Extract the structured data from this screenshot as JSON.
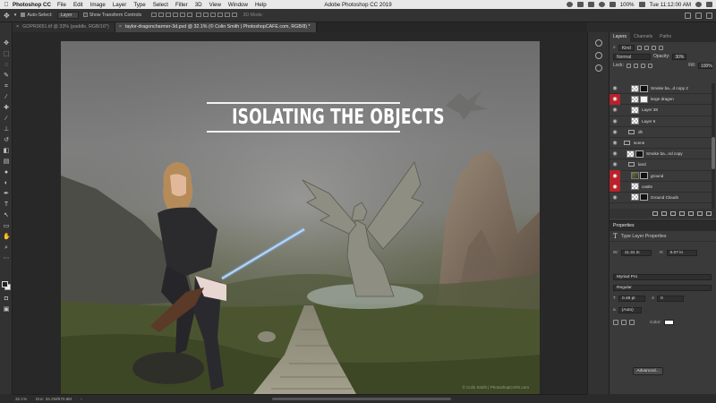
{
  "menubar": {
    "app_name": "Photoshop CC",
    "items": [
      "File",
      "Edit",
      "Image",
      "Layer",
      "Type",
      "Select",
      "Filter",
      "3D",
      "View",
      "Window",
      "Help"
    ],
    "window_title": "Adobe Photoshop CC 2019",
    "battery": "100%",
    "clock": "Tue 11:12:00 AM"
  },
  "options": {
    "auto_select_label": "Auto-Select:",
    "auto_select_value": "Layer",
    "transform_label": "Show Transform Controls",
    "mode_3d": "3D Mode:"
  },
  "tabs": [
    {
      "label": "GOPR0051.tif @ 33% (paddle, RGB/16*)",
      "active": false
    },
    {
      "label": "taylor-dragoncharmer-3d.psd @ 32.1% (© Colin Smith | PhotoshopCAFE.com, RGB/8) *",
      "active": true
    }
  ],
  "artwork": {
    "headline": "ISOLATING THE OBJECTS",
    "watermark": "© Colin Smith | PhotoshopCAFE.com"
  },
  "layers_panel": {
    "tabs": [
      "Layers",
      "Channels",
      "Paths"
    ],
    "filter_label": "Kind",
    "blend_mode": "Normal",
    "opacity_label": "Opacity:",
    "opacity_value": "30%",
    "lock_label": "Lock:",
    "fill_label": "Fill:",
    "fill_value": "100%",
    "layers": [
      {
        "name": "Smoke ba...d copy 2",
        "red_eye": false,
        "kind": "mask",
        "selected": false,
        "indent": 2
      },
      {
        "name": "large dragon",
        "red_eye": true,
        "kind": "maskw",
        "selected": false,
        "indent": 2,
        "link": true
      },
      {
        "name": "Layer 38",
        "red_eye": false,
        "kind": "plain",
        "selected": false,
        "indent": 2
      },
      {
        "name": "Layer 6",
        "red_eye": false,
        "kind": "plain",
        "selected": false,
        "indent": 2
      },
      {
        "name": "dh",
        "red_eye": false,
        "kind": "folder",
        "selected": false,
        "indent": 1
      },
      {
        "name": "scene",
        "red_eye": false,
        "kind": "folder",
        "selected": false,
        "indent": 0
      },
      {
        "name": "Smoke ba...nd copy",
        "red_eye": false,
        "kind": "mask",
        "selected": false,
        "indent": 1
      },
      {
        "name": "land",
        "red_eye": false,
        "kind": "folder",
        "selected": false,
        "indent": 1
      },
      {
        "name": "ground",
        "red_eye": true,
        "kind": "photo",
        "selected": false,
        "indent": 2
      },
      {
        "name": "castle",
        "red_eye": true,
        "kind": "plain",
        "selected": false,
        "indent": 2
      },
      {
        "name": "Ground Clouds",
        "red_eye": false,
        "kind": "mask",
        "selected": false,
        "indent": 2
      }
    ]
  },
  "properties": {
    "title": "Properties",
    "subtitle": "Type Layer Properties",
    "w_label": "W:",
    "w_value": "11.31 in",
    "h_label": "H:",
    "h_value": "0.07 in",
    "font_family": "Myriad Pro",
    "font_style": "Regular",
    "font_size": "0.48 pt",
    "leading": "0",
    "anti_alias": "(Auto)",
    "color_label": "Color:",
    "advanced_label": "Advanced..."
  },
  "statusbar": {
    "zoom": "32.1%",
    "doc": "Doc: 34.2M/570.8M"
  },
  "colors": {
    "selection_red": "#b8222a",
    "ui_dark": "#323232"
  }
}
